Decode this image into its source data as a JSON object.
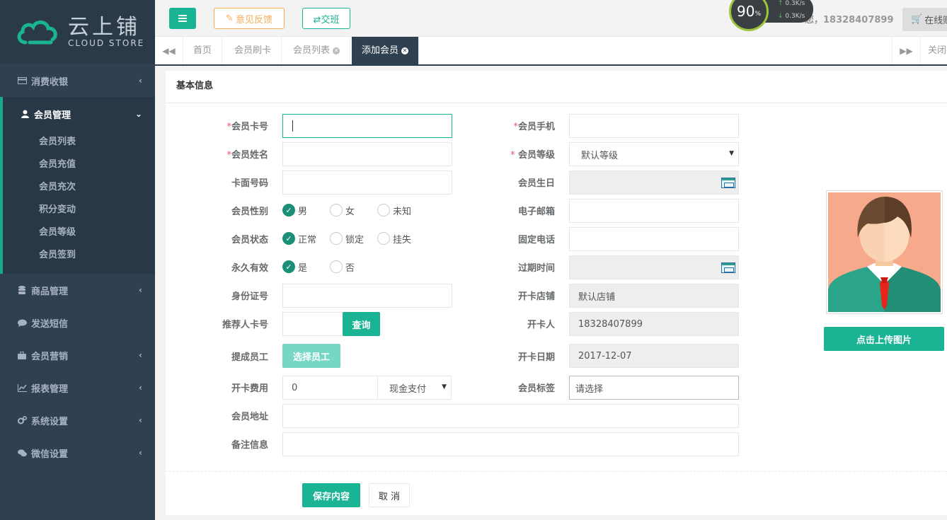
{
  "colors": {
    "sidebar": "#2f4050",
    "accent": "#1ab394",
    "warning": "#f8ac59",
    "required": "#ed5565"
  },
  "logo": {
    "zh": "云上铺",
    "en": "CLOUD STORE"
  },
  "sidebar": {
    "items": [
      {
        "label": "消费收银",
        "icon": "credit-card-icon"
      },
      {
        "label": "会员管理",
        "icon": "user-icon"
      },
      {
        "label": "商品管理",
        "icon": "database-icon"
      },
      {
        "label": "发送短信",
        "icon": "comment-icon"
      },
      {
        "label": "会员营销",
        "icon": "briefcase-icon"
      },
      {
        "label": "报表管理",
        "icon": "line-chart-icon"
      },
      {
        "label": "系统设置",
        "icon": "gears-icon"
      },
      {
        "label": "微信设置",
        "icon": "comments-icon"
      }
    ],
    "sub_items": [
      "会员列表",
      "会员充值",
      "会员充次",
      "积分变动",
      "会员等级",
      "会员签到"
    ]
  },
  "topbar": {
    "feedback": "意见反馈",
    "shift": "⇄交班",
    "gauge": "90",
    "gauge_unit": "%",
    "up_speed": "0.3",
    "down_speed": "0.3",
    "speed_unit": "K/s",
    "user": "您，18328407899",
    "online": "在线购"
  },
  "tabs": [
    "首页",
    "会员刷卡",
    "会员列表",
    "添加会员"
  ],
  "tab_close": "关闭操作",
  "form": {
    "section_title": "基本信息",
    "left": {
      "card_no": "会员卡号",
      "name": "会员姓名",
      "face_no": "卡面号码",
      "gender": "会员性别",
      "status": "会员状态",
      "permanent": "永久有效",
      "id_card": "身份证号",
      "referrer": "推荐人卡号",
      "commission": "提成员工",
      "fee": "开卡费用",
      "address": "会员地址",
      "remark": "备注信息"
    },
    "right": {
      "phone": "会员手机",
      "level": "会员等级",
      "birthday": "会员生日",
      "email": "电子邮箱",
      "tel": "固定电话",
      "expire": "过期时间",
      "store": "开卡店铺",
      "opener": "开卡人",
      "open_date": "开卡日期",
      "tag": "会员标签"
    },
    "gender_options": [
      "男",
      "女",
      "未知"
    ],
    "status_options": [
      "正常",
      "锁定",
      "挂失"
    ],
    "permanent_options": [
      "是",
      "否"
    ],
    "level_value": "默认等级",
    "store_value": "默认店铺",
    "opener_value": "18328407899",
    "open_date_value": "2017-12-07",
    "tag_value": "请选择",
    "fee_value": "0",
    "pay_value": "现金支付",
    "query_btn": "查询",
    "choose_staff_btn": "选择员工",
    "upload_btn": "点击上传图片",
    "save_btn": "保存内容",
    "cancel_btn": "取 消"
  }
}
